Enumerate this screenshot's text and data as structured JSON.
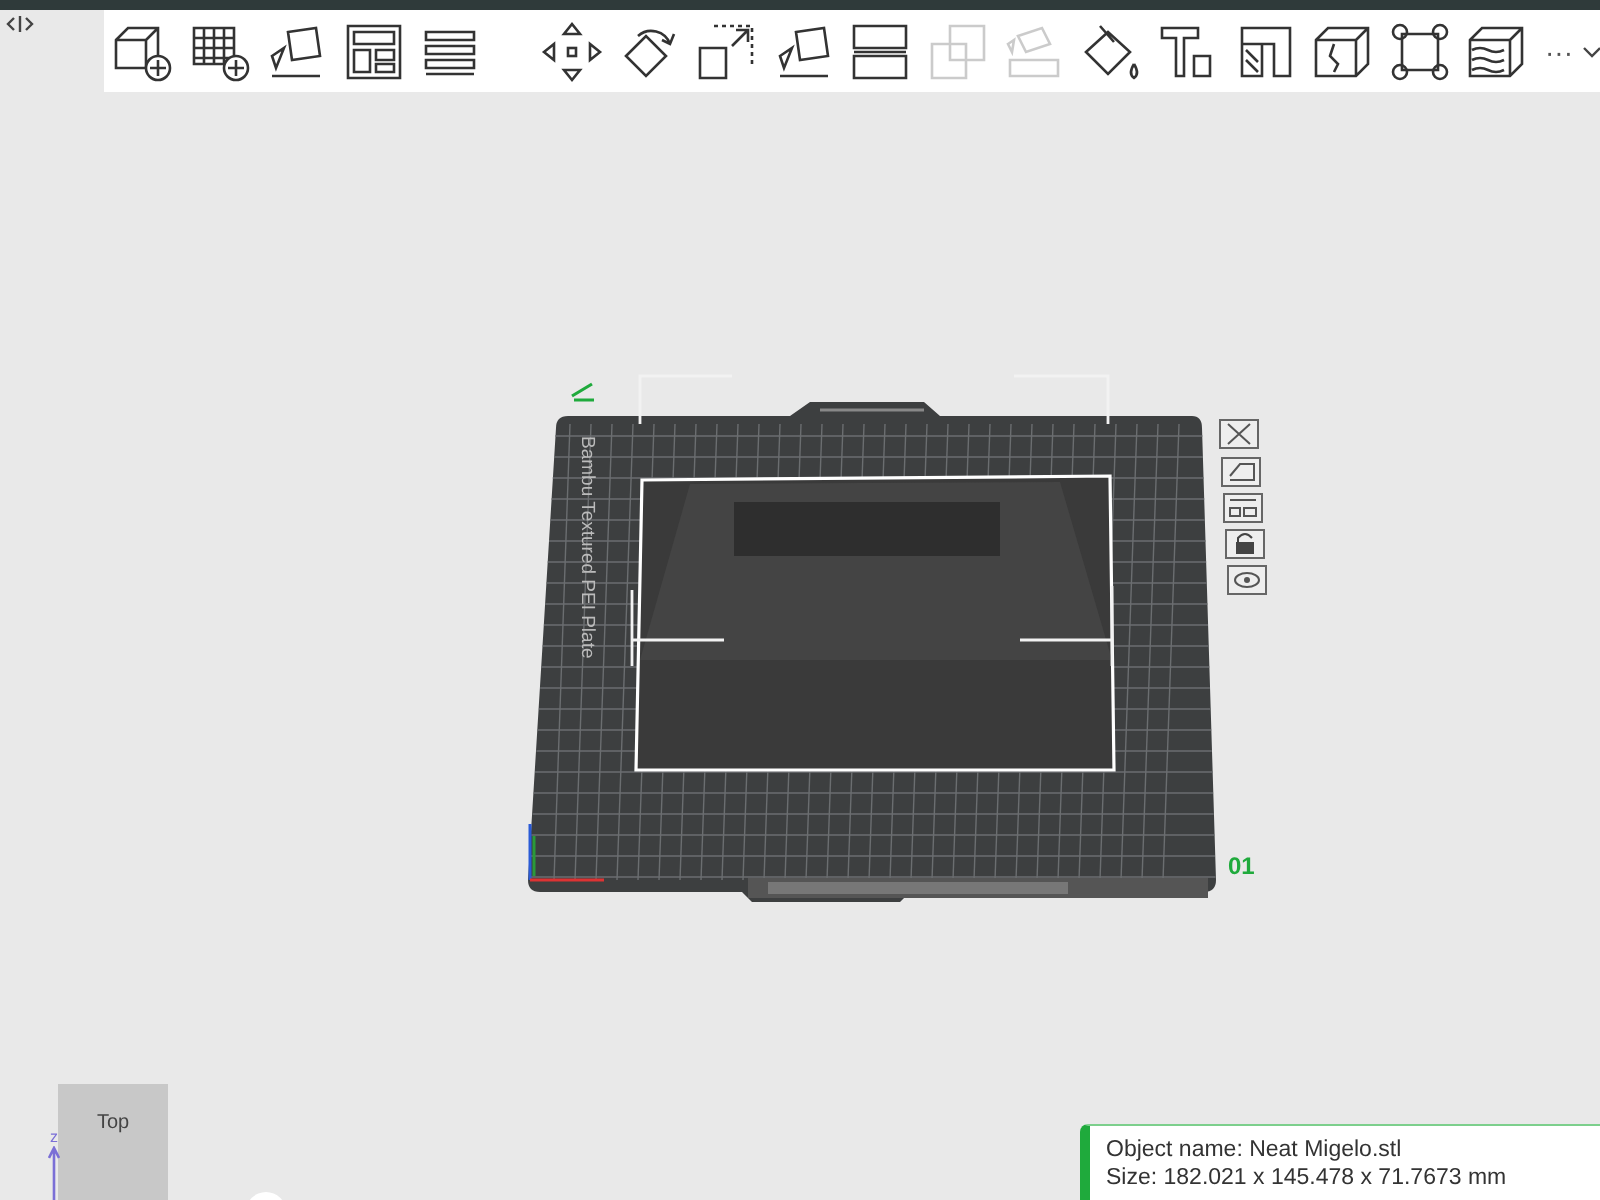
{
  "toolbar": {
    "tools": [
      {
        "kind": "add-cube",
        "disabled": false
      },
      {
        "kind": "add-plate",
        "disabled": false
      },
      {
        "kind": "auto-orient",
        "disabled": false
      },
      {
        "kind": "arrange",
        "disabled": false
      },
      {
        "kind": "layers",
        "disabled": false
      },
      {
        "kind": "separator"
      },
      {
        "kind": "move",
        "disabled": false
      },
      {
        "kind": "rotate",
        "disabled": false
      },
      {
        "kind": "scale",
        "disabled": false
      },
      {
        "kind": "lay-flat",
        "disabled": false
      },
      {
        "kind": "cut",
        "disabled": false
      },
      {
        "kind": "overlap",
        "disabled": true
      },
      {
        "kind": "split",
        "disabled": true
      },
      {
        "kind": "paint",
        "disabled": false
      },
      {
        "kind": "text",
        "disabled": false
      },
      {
        "kind": "height-range",
        "disabled": false
      },
      {
        "kind": "seam",
        "disabled": false
      },
      {
        "kind": "brim-ears",
        "disabled": false
      },
      {
        "kind": "fuzzy",
        "disabled": false
      }
    ],
    "more": "···"
  },
  "plate": {
    "label": "Bambu Textured PEI Plate",
    "number": "01"
  },
  "view_cube": {
    "faces": [
      "Top"
    ],
    "axis": "z"
  },
  "object_info": {
    "lines": [
      "Object name: Neat Migelo.stl",
      "Size: 182.021 x 145.478 x 71.7673 mm"
    ]
  }
}
